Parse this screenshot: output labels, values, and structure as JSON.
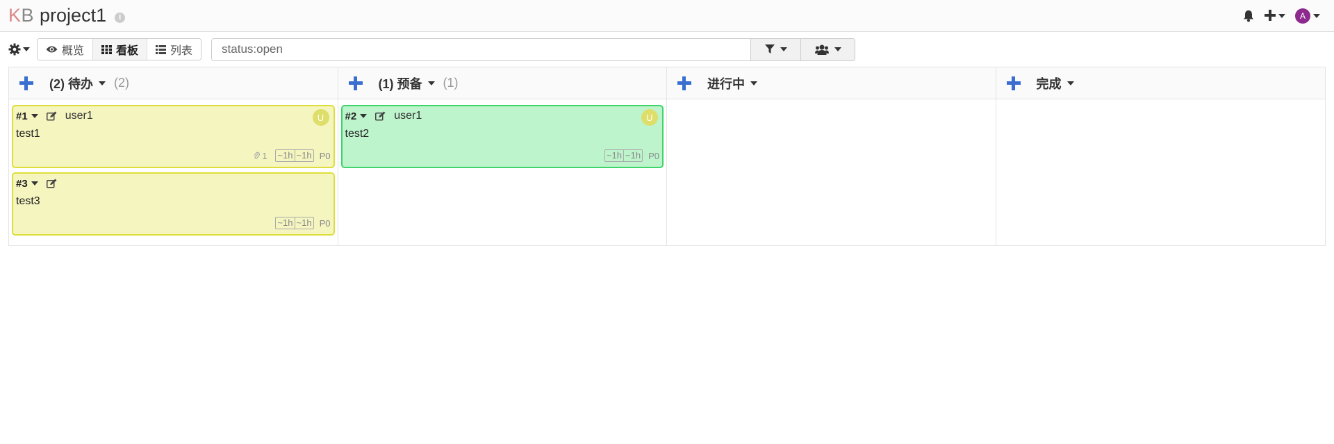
{
  "header": {
    "logo_k": "K",
    "logo_b": "B",
    "project_title": "project1",
    "info_glyph": "i",
    "avatar_letter": "A"
  },
  "toolbar": {
    "views": [
      {
        "label": "概览",
        "icon": "eye-icon"
      },
      {
        "label": "看板",
        "icon": "grid-icon",
        "active": true
      },
      {
        "label": "列表",
        "icon": "list-icon"
      }
    ],
    "search_value": "status:open"
  },
  "board": {
    "columns": [
      {
        "title": "(2) 待办",
        "count": "(2)"
      },
      {
        "title": "(1) 预备",
        "count": "(1)"
      },
      {
        "title": "进行中",
        "count": ""
      },
      {
        "title": "完成",
        "count": ""
      }
    ],
    "cards": [
      {
        "id": "#1",
        "assignee": "user1",
        "avatar": "U",
        "title": "test1",
        "attachments": "1",
        "estimate": "~1h",
        "spent": "~1h",
        "priority": "P0",
        "color": "#f5f5c0"
      },
      {
        "id": "#3",
        "assignee": "",
        "avatar": "",
        "title": "test3",
        "attachments": "",
        "estimate": "~1h",
        "spent": "~1h",
        "priority": "P0",
        "color": "#f5f5c0"
      },
      {
        "id": "#2",
        "assignee": "user1",
        "avatar": "U",
        "title": "test2",
        "attachments": "",
        "estimate": "~1h",
        "spent": "~1h",
        "priority": "P0",
        "color": "#bdf4cc"
      }
    ]
  },
  "colors": {
    "accent_blue": "#3a6fd0",
    "card_yellow_border": "#dede3a",
    "card_green_border": "#3fd56a",
    "avatar_purple": "#8e2a8e"
  }
}
